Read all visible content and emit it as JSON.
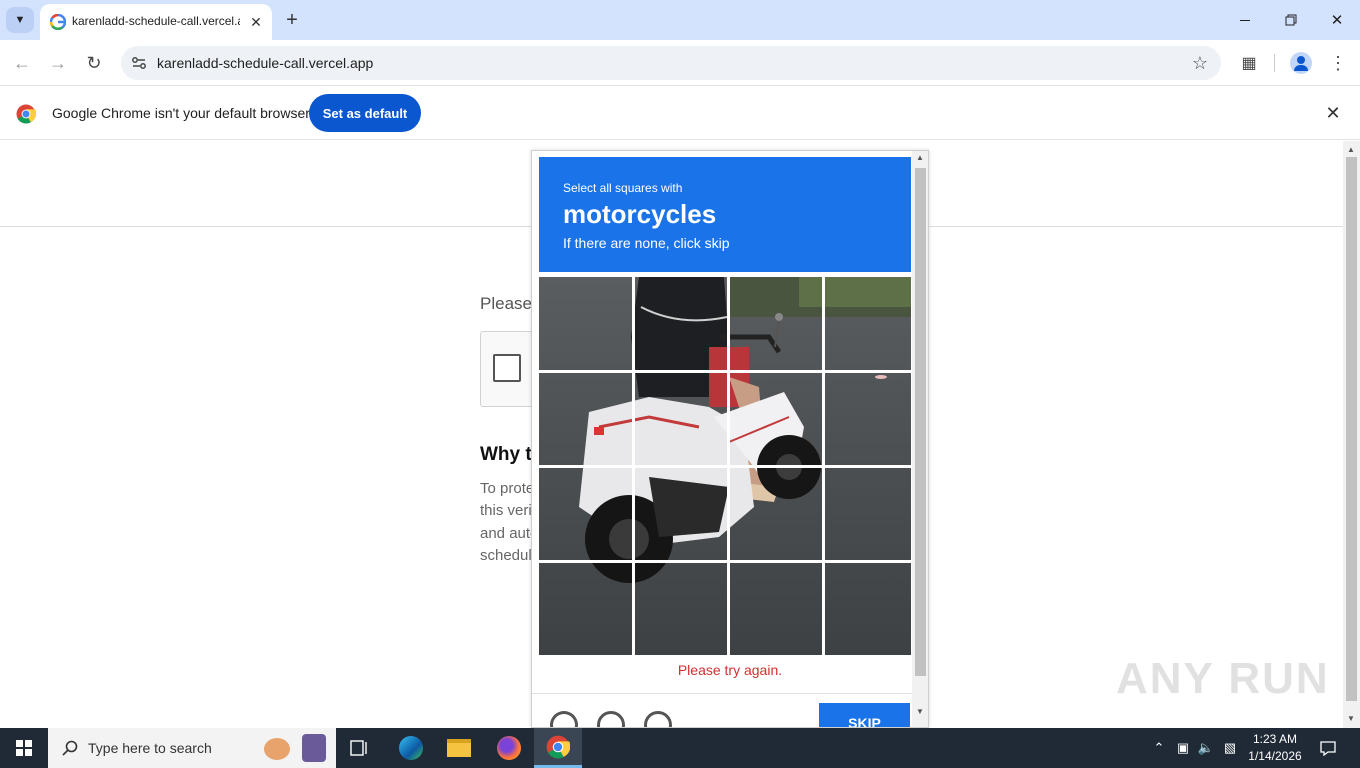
{
  "browser": {
    "tab_title": "karenladd-schedule-call.vercel.app",
    "url": "karenladd-schedule-call.vercel.app"
  },
  "infobar": {
    "message": "Google Chrome isn't your default browser",
    "set_default_label": "Set as default"
  },
  "page": {
    "prompt_partial": "Please",
    "why_heading_partial": "Why t",
    "why_lines_partial": [
      "To prote",
      "this veri",
      "and auto",
      "schedul"
    ]
  },
  "captcha": {
    "instruction_line1": "Select all squares with",
    "keyword": "motorcycles",
    "instruction_line3": "If there are none, click skip",
    "error": "Please try again.",
    "skip_label": "SKIP",
    "grid_size": "4x4",
    "accent_color": "#1a73e8",
    "error_color": "#d32f2f"
  },
  "taskbar": {
    "search_placeholder": "Type here to search",
    "time": "1:23 AM",
    "date": "1/14/2026"
  },
  "watermark": "ANY RUN"
}
